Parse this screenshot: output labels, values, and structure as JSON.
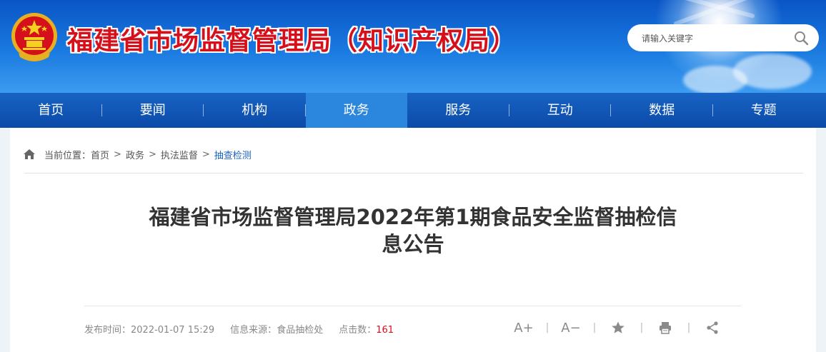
{
  "header": {
    "site_title": "福建省市场监督管理局（知识产权局）",
    "search": {
      "placeholder": "请输入关键字"
    }
  },
  "nav": {
    "items": [
      {
        "label": "首页"
      },
      {
        "label": "要闻"
      },
      {
        "label": "机构"
      },
      {
        "label": "政务"
      },
      {
        "label": "服务"
      },
      {
        "label": "互动"
      },
      {
        "label": "数据"
      },
      {
        "label": "专题"
      }
    ],
    "active_label": "政务"
  },
  "breadcrumb": {
    "prefix": "当前位置：",
    "items": [
      "首页",
      "政务",
      "执法监督",
      "抽查检测"
    ],
    "separator": ">"
  },
  "article": {
    "title_line1": "福建省市场监督管理局2022年第1期食品安全监督抽检信",
    "title_line2": "息公告",
    "publish_label": "发布时间：",
    "publish_time": "2022-01-07 15:29",
    "source_label": "信息来源：",
    "source": "食品抽检处",
    "hits_label": "点击数：",
    "hits": "161"
  },
  "tools": {
    "font_larger": "A+",
    "font_smaller": "A−",
    "separator": "|"
  },
  "colors": {
    "title_red": "#d6101a",
    "nav_blue": "#0b4aa8",
    "nav_active": "#2b86de",
    "link_blue": "#1a62c2"
  }
}
